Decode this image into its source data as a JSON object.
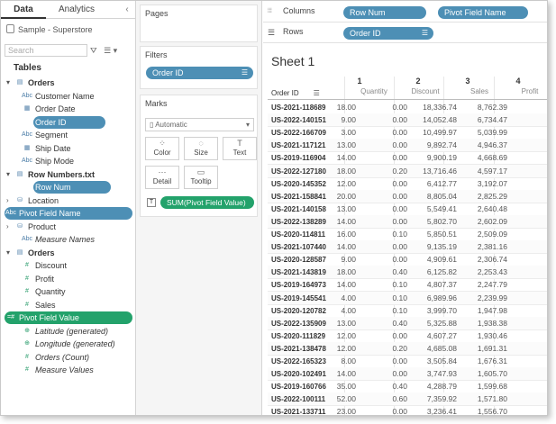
{
  "tabs": {
    "data": "Data",
    "analytics": "Analytics",
    "collapse": "‹"
  },
  "datasource": "Sample - Superstore",
  "search": {
    "placeholder": "Search",
    "filter_icon": "⛛",
    "view_icon": "☰ ▾"
  },
  "tables_label": "Tables",
  "fields": [
    {
      "arrow": "▾",
      "icon": "▤",
      "label": "Orders",
      "kind": "table"
    },
    {
      "icon": "Abc",
      "label": "Customer Name",
      "kind": "dim"
    },
    {
      "icon": "▦",
      "label": "Order Date",
      "kind": "dim"
    },
    {
      "icon": "Abc",
      "label": "Order ID",
      "kind": "dim",
      "selected": true
    },
    {
      "icon": "Abc",
      "label": "Segment",
      "kind": "dim"
    },
    {
      "icon": "▦",
      "label": "Ship Date",
      "kind": "dim"
    },
    {
      "icon": "Abc",
      "label": "Ship Mode",
      "kind": "dim"
    },
    {
      "arrow": "▾",
      "icon": "▤",
      "label": "Row Numbers.txt",
      "kind": "table"
    },
    {
      "icon": "#",
      "label": "Row Num",
      "kind": "dim",
      "selected": true
    },
    {
      "arrow": "›",
      "icon": "⛁",
      "label": "Location",
      "kind": "group"
    },
    {
      "icon": "Abc",
      "label": "Pivot Field Name",
      "kind": "dim",
      "selected": true,
      "wide": true
    },
    {
      "arrow": "›",
      "icon": "⛁",
      "label": "Product",
      "kind": "group"
    },
    {
      "icon": "Abc",
      "label": "Measure Names",
      "kind": "italic"
    },
    {
      "arrow": "▾",
      "icon": "▤",
      "label": "Orders",
      "kind": "table"
    },
    {
      "icon": "#",
      "label": "Discount",
      "kind": "meas"
    },
    {
      "icon": "#",
      "label": "Profit",
      "kind": "meas"
    },
    {
      "icon": "#",
      "label": "Quantity",
      "kind": "meas"
    },
    {
      "icon": "#",
      "label": "Sales",
      "kind": "meas"
    },
    {
      "icon": "=#",
      "label": "Pivot Field Value",
      "kind": "meas",
      "selected": true,
      "wide": true,
      "green": true
    },
    {
      "icon": "⊕",
      "label": "Latitude (generated)",
      "kind": "italic-meas"
    },
    {
      "icon": "⊕",
      "label": "Longitude (generated)",
      "kind": "italic-meas"
    },
    {
      "icon": "#",
      "label": "Orders (Count)",
      "kind": "italic-meas"
    },
    {
      "icon": "#",
      "label": "Measure Values",
      "kind": "italic-meas"
    }
  ],
  "pages_label": "Pages",
  "filters_label": "Filters",
  "filter_pill": "Order ID",
  "marks": {
    "label": "Marks",
    "type": "Automatic",
    "type_icon": "▯",
    "buttons": [
      {
        "icon": "⁘",
        "label": "Color"
      },
      {
        "icon": "◌",
        "label": "Size"
      },
      {
        "icon": "T",
        "label": "Text"
      },
      {
        "icon": "⋯",
        "label": "Detail"
      },
      {
        "icon": "▭",
        "label": "Tooltip"
      }
    ],
    "text_pill": "SUM(Pivot Field Value)",
    "text_pill_icon": "T"
  },
  "columns": {
    "label": "Columns",
    "icon": "⦙⦙⦙",
    "pills": [
      "Row Num",
      "Pivot Field Name"
    ]
  },
  "rows": {
    "label": "Rows",
    "icon": "☰",
    "pills": [
      "Order ID"
    ]
  },
  "sheet_title": "Sheet 1",
  "table": {
    "row_header": "Order ID",
    "col_numbers": [
      "1",
      "2",
      "3",
      "4"
    ],
    "col_fields": [
      "Quantity",
      "Discount",
      "Sales",
      "Profit"
    ],
    "rows": [
      [
        "US-2021-118689",
        "18.00",
        "0.00",
        "18,336.74",
        "8,762.39"
      ],
      [
        "US-2022-140151",
        "9.00",
        "0.00",
        "14,052.48",
        "6,734.47"
      ],
      [
        "US-2022-166709",
        "3.00",
        "0.00",
        "10,499.97",
        "5,039.99"
      ],
      [
        "US-2021-117121",
        "13.00",
        "0.00",
        "9,892.74",
        "4,946.37"
      ],
      [
        "US-2019-116904",
        "14.00",
        "0.00",
        "9,900.19",
        "4,668.69"
      ],
      [
        "US-2022-127180",
        "18.00",
        "0.20",
        "13,716.46",
        "4,597.17"
      ],
      [
        "US-2020-145352",
        "12.00",
        "0.00",
        "6,412.77",
        "3,192.07"
      ],
      [
        "US-2021-158841",
        "20.00",
        "0.00",
        "8,805.04",
        "2,825.29"
      ],
      [
        "US-2021-140158",
        "13.00",
        "0.00",
        "5,549.41",
        "2,640.48"
      ],
      [
        "US-2022-138289",
        "14.00",
        "0.00",
        "5,802.70",
        "2,602.09"
      ],
      [
        "US-2020-114811",
        "16.00",
        "0.10",
        "5,850.51",
        "2,509.09"
      ],
      [
        "US-2021-107440",
        "14.00",
        "0.00",
        "9,135.19",
        "2,381.16"
      ],
      [
        "US-2020-128587",
        "9.00",
        "0.00",
        "4,909.61",
        "2,306.74"
      ],
      [
        "US-2021-143819",
        "18.00",
        "0.40",
        "6,125.82",
        "2,253.43"
      ],
      [
        "US-2019-164973",
        "14.00",
        "0.10",
        "4,807.37",
        "2,247.79"
      ],
      [
        "US-2019-145541",
        "4.00",
        "0.10",
        "6,989.96",
        "2,239.99"
      ],
      [
        "US-2020-120782",
        "4.00",
        "0.10",
        "3,999.70",
        "1,947.98"
      ],
      [
        "US-2022-135909",
        "13.00",
        "0.40",
        "5,325.88",
        "1,938.38"
      ],
      [
        "US-2020-111829",
        "12.00",
        "0.00",
        "4,607.27",
        "1,930.46"
      ],
      [
        "US-2021-138478",
        "12.00",
        "0.20",
        "4,685.08",
        "1,691.31"
      ],
      [
        "US-2022-165323",
        "8.00",
        "0.00",
        "3,505.84",
        "1,676.31"
      ],
      [
        "US-2020-102491",
        "14.00",
        "0.00",
        "3,747.93",
        "1,605.70"
      ],
      [
        "US-2019-160766",
        "35.00",
        "0.40",
        "4,288.79",
        "1,599.68"
      ],
      [
        "US-2022-100111",
        "52.00",
        "0.60",
        "7,359.92",
        "1,571.80"
      ],
      [
        "US-2021-133711",
        "23.00",
        "0.00",
        "3,236.41",
        "1,556.70"
      ]
    ]
  },
  "colors": {
    "blue_pill": "#4d8fb5",
    "green_pill": "#23a26b"
  }
}
